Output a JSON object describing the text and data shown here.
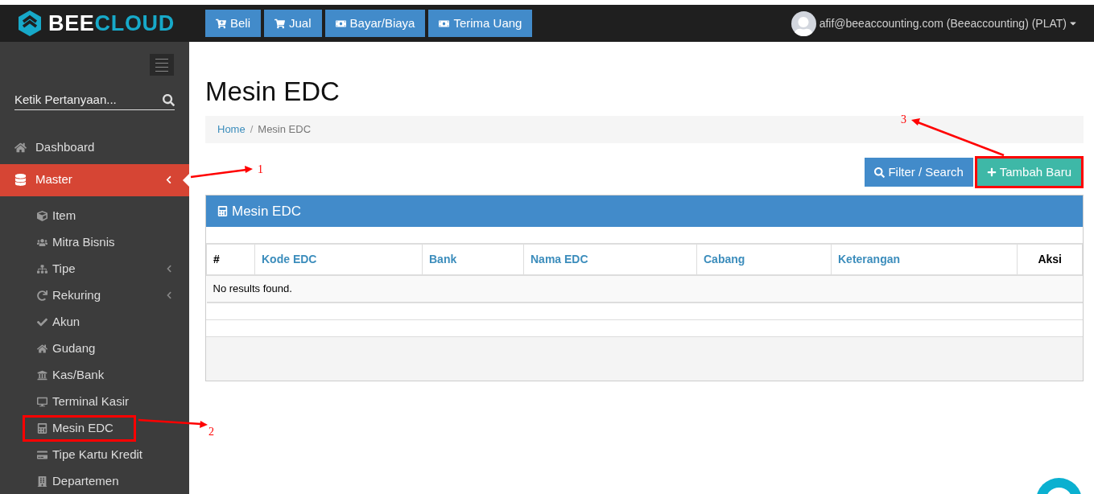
{
  "header": {
    "logo": {
      "part_1": "BEE",
      "part_2": "CLOUD"
    },
    "actions": [
      {
        "label": "Beli"
      },
      {
        "label": "Jual"
      },
      {
        "label": "Bayar/Biaya"
      },
      {
        "label": "Terima Uang"
      }
    ],
    "user": {
      "label": "afif@beeaccounting.com (Beeaccounting) (PLAT)"
    }
  },
  "sidebar": {
    "search": {
      "placeholder": "Ketik Pertanyaan..."
    },
    "items": [
      {
        "label": "Dashboard",
        "selected": false
      },
      {
        "label": "Master",
        "selected": true,
        "expanded": true,
        "children": [
          {
            "label": "Item",
            "has_submenu": false,
            "highlighted": false
          },
          {
            "label": "Mitra Bisnis",
            "has_submenu": false,
            "highlighted": false
          },
          {
            "label": "Tipe",
            "has_submenu": true,
            "highlighted": false
          },
          {
            "label": "Rekuring",
            "has_submenu": true,
            "highlighted": false
          },
          {
            "label": "Akun",
            "has_submenu": false,
            "highlighted": false
          },
          {
            "label": "Gudang",
            "has_submenu": false,
            "highlighted": false
          },
          {
            "label": "Kas/Bank",
            "has_submenu": false,
            "highlighted": false
          },
          {
            "label": "Terminal Kasir",
            "has_submenu": false,
            "highlighted": false
          },
          {
            "label": "Mesin EDC",
            "has_submenu": false,
            "highlighted": true
          },
          {
            "label": "Tipe Kartu Kredit",
            "has_submenu": false,
            "highlighted": false
          },
          {
            "label": "Departemen",
            "has_submenu": false,
            "highlighted": false
          }
        ]
      }
    ]
  },
  "page": {
    "title": "Mesin EDC",
    "breadcrumb_separator": "/",
    "breadcrumb": [
      {
        "label": "Home",
        "link": true
      },
      {
        "label": "Mesin EDC",
        "link": false
      }
    ],
    "buttons": [
      {
        "label": "Filter / Search",
        "kind": "filter",
        "highlighted": false
      },
      {
        "label": "Tambah Baru",
        "kind": "add",
        "highlighted": true
      }
    ],
    "panel": {
      "title": "Mesin EDC",
      "table": {
        "columns": [
          {
            "label": "#",
            "sortable": false
          },
          {
            "label": "Kode EDC",
            "sortable": true
          },
          {
            "label": "Bank",
            "sortable": true
          },
          {
            "label": "Nama EDC",
            "sortable": true
          },
          {
            "label": "Cabang",
            "sortable": true
          },
          {
            "label": "Keterangan",
            "sortable": true
          },
          {
            "label": "Aksi",
            "sortable": false
          }
        ],
        "empty_message": "No results found."
      }
    }
  },
  "annotations": [
    {
      "label": "1"
    },
    {
      "label": "2"
    },
    {
      "label": "3"
    }
  ]
}
